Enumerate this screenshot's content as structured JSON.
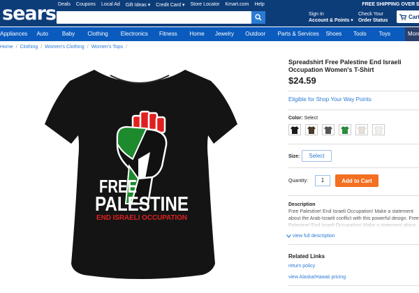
{
  "header": {
    "logo_text": "sears",
    "util_links": [
      "Deals",
      "Coupons",
      "Local Ad",
      "Gift Ideas ▾",
      "Credit Card ▾",
      "Store Locator",
      "Kmart.com",
      "Help"
    ],
    "search_placeholder": "",
    "sign_in": {
      "line1": "Sign In",
      "line2": "Account & Points ▾"
    },
    "order_status": {
      "line1": "Check Your",
      "line2": "Order Status"
    },
    "free_shipping": "FREE SHIPPING OVER $",
    "cart_label": "Cart",
    "colors": {
      "header_bg": "#0d3d79",
      "nav_bg": "#0a5bbd",
      "accent_blue": "#2b7bd4",
      "cta_orange": "#f36f21"
    }
  },
  "nav": {
    "items": [
      "Appliances",
      "Auto",
      "Baby",
      "Clothing",
      "Electronics",
      "Fitness",
      "Home",
      "Jewelry",
      "Outdoor",
      "Parts & Services",
      "Shoes",
      "Tools",
      "Toys",
      "More"
    ]
  },
  "breadcrumb": [
    "Home",
    "Clothing",
    "Women's Clothing",
    "Women's Tops"
  ],
  "product": {
    "title": "Spreadshirt Free Palestine End Israeli Occupation Women's T-Shirt",
    "price": "$24.59",
    "shop_your_way": "Eligible for Shop Your Way Points",
    "color_label": "Color:",
    "color_value": "Select",
    "swatch_colors": [
      "#1a1a1a",
      "#4a3a2a",
      "#555555",
      "#2e8b3d",
      "#e8e0d8",
      "#f2f0ea"
    ],
    "size_label": "Size:",
    "size_select": "Select",
    "qty_label": "Quantity:",
    "qty_value": "1",
    "add_to_cart": "Add to Cart",
    "description_heading": "Description",
    "description_text": "Free Palestine! End Israeli Occupation! Make a statement about the Arab-Israeli conflict with this powerful design. Free Palestine! End Israeli Occupation! Make a statement about",
    "view_full": "view full description",
    "related_heading": "Related Links",
    "related_links": [
      "return policy",
      "view Alaska/Hawaii pricing"
    ],
    "shirt_print": {
      "line1": "FREE",
      "line2": "PALESTINE",
      "line3": "END ISRAELI OCCUPATION"
    }
  }
}
